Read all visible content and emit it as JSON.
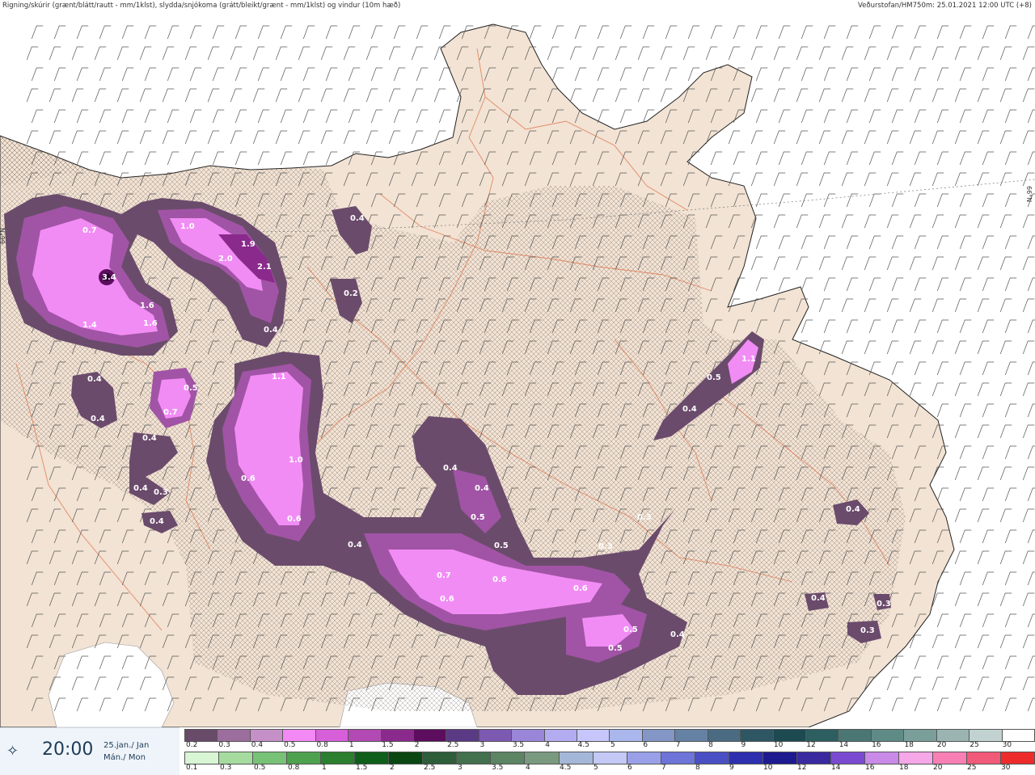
{
  "header": {
    "title": "Rigning/skúrir (grænt/blátt/rautt - mm/1klst), slydda/snjókoma (grátt/bleikt/grænt - mm/1klst) og vindur (10m hæð)",
    "source": "Veðurstofan/HM750m: 25.01.2021 12:00 UTC (+8)"
  },
  "timebox": {
    "icon": "play-step-icon",
    "time": "20:00",
    "date_line1": "25.jan./ Jan",
    "date_line2": "Mán./ Mon"
  },
  "grid_labels": {
    "lat_left": "66°N",
    "lat_right": "66°N"
  },
  "map_labels": [
    "0.7",
    "3.4",
    "1.4",
    "1.6",
    "1.6",
    "1.0",
    "1.9",
    "2.0",
    "2.1",
    "0.4",
    "0.4",
    "0.2",
    "1.1",
    "0.4",
    "0.4",
    "0.5",
    "0.7",
    "0.4",
    "0.4",
    "0.3",
    "0.4",
    "0.6",
    "1.0",
    "0.6",
    "0.4",
    "0.4",
    "0.4",
    "0.5",
    "0.5",
    "0.3",
    "0.3",
    "0.7",
    "0.6",
    "0.6",
    "0.6",
    "0.5",
    "0.5",
    "0.4",
    "1.1",
    "0.5",
    "0.4",
    "0.4",
    "0.4",
    "0.3",
    "0.3"
  ],
  "colors": {
    "land": "#f2e3d4",
    "sea": "#ffffff",
    "roads": "#e07a52",
    "snow_dark": "#6b4b6c",
    "snow_mid": "#b45fb8",
    "snow_light": "#f28cf5"
  },
  "legend_snow": {
    "ticks": [
      "0.2",
      "0.3",
      "0.4",
      "0.5",
      "0.8",
      "1",
      "1.5",
      "2",
      "2.5",
      "3",
      "3.5",
      "4",
      "4.5",
      "5",
      "6",
      "7",
      "8",
      "9",
      "10",
      "12",
      "14",
      "16",
      "18",
      "20",
      "25",
      "30"
    ],
    "colors": [
      "#674b68",
      "#9c6e9e",
      "#c590c8",
      "#f389f5",
      "#d75fda",
      "#b349b4",
      "#8a2a8c",
      "#5c0d5e",
      "#5a3a85",
      "#7c5ab2",
      "#9a86d8",
      "#b3acf0",
      "#c6c6fb",
      "#aab7ec",
      "#8396c5",
      "#6582a4",
      "#4b6b82",
      "#2f5663",
      "#1c4a50",
      "#2d5e60",
      "#4a7674",
      "#5f8b87",
      "#7a9e9a",
      "#9bb4b2",
      "#c1d2d0",
      "#ffffff"
    ]
  },
  "legend_rain": {
    "ticks": [
      "0.1",
      "0.3",
      "0.5",
      "0.8",
      "1",
      "1.5",
      "2",
      "2.5",
      "3",
      "3.5",
      "4",
      "4.5",
      "5",
      "6",
      "7",
      "8",
      "9",
      "10",
      "12",
      "14",
      "16",
      "18",
      "20",
      "25",
      "30"
    ],
    "colors": [
      "#d8f5d4",
      "#a6dba0",
      "#78c277",
      "#4ea24f",
      "#2b7f2e",
      "#0f5f1a",
      "#0b4712",
      "#2e5d3a",
      "#43704d",
      "#5d8463",
      "#7a9a7f",
      "#a4b7d9",
      "#c3c9f4",
      "#9aa0e8",
      "#6e74d8",
      "#4a50c4",
      "#2d2fae",
      "#1e1a90",
      "#3a2aa0",
      "#7a4bd0",
      "#c98ae8",
      "#f5a7e8",
      "#f77fb4",
      "#f25a7a",
      "#ee2b2b"
    ]
  }
}
